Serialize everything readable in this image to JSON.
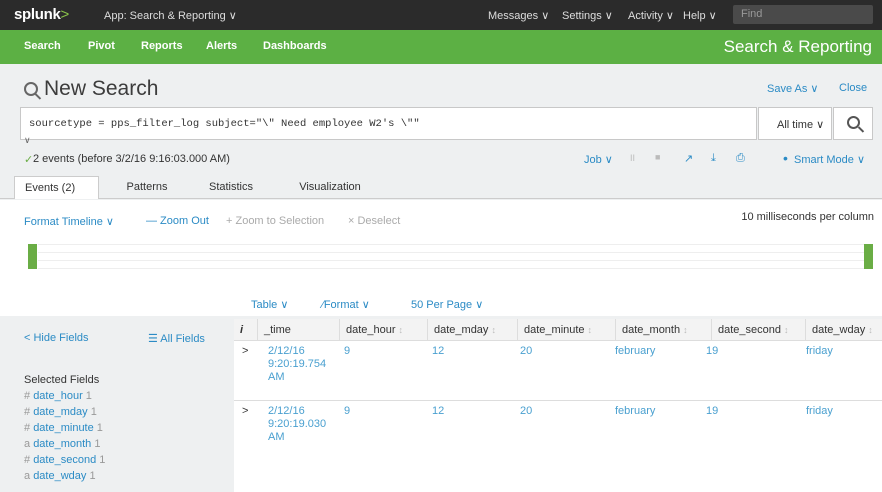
{
  "topbar": {
    "logo": "splunk",
    "logo_suffix": ">",
    "app": "App: Search & Reporting ∨",
    "messages": "Messages ∨",
    "settings": "Settings ∨",
    "activity": "Activity ∨",
    "help": "Help ∨",
    "find_placeholder": "Find"
  },
  "appnav": {
    "items": [
      "Search",
      "Pivot",
      "Reports",
      "Alerts",
      "Dashboards"
    ],
    "app_title": "Search & Reporting"
  },
  "page": {
    "title": "New Search",
    "save_as": "Save As ∨",
    "close": "Close"
  },
  "search": {
    "query": "sourcetype = pps_filter_log subject=\"\\\" Need employee W2's \\\"\"",
    "time_range": "All time ∨",
    "collapse": "∨"
  },
  "status": {
    "check": "✓",
    "events_text": "2 events (before 3/2/16 9:16:03.000 AM)",
    "job": "Job ∨",
    "pause": "II",
    "stop": "■",
    "share": "↗",
    "export": "⤓",
    "print": "⎙",
    "bulb": "•",
    "mode": "Smart Mode ∨"
  },
  "tabs": [
    "Events (2)",
    "Patterns",
    "Statistics",
    "Visualization"
  ],
  "timeline": {
    "format": "Format Timeline ∨",
    "zoom_out": "— Zoom Out",
    "zoom_selection": "+ Zoom to Selection",
    "deselect": "× Deselect",
    "scale": "10 milliseconds per column"
  },
  "toolbar": {
    "table": "Table ∨",
    "format": "∕Format ∨",
    "per_page": "50 Per Page ∨"
  },
  "fields": {
    "hide": "< Hide Fields",
    "all": "☰ All Fields",
    "selected_heading": "Selected Fields",
    "list": [
      {
        "type": "#",
        "name": "date_hour",
        "count": "1"
      },
      {
        "type": "#",
        "name": "date_mday",
        "count": "1"
      },
      {
        "type": "#",
        "name": "date_minute",
        "count": "1"
      },
      {
        "type": "a",
        "name": "date_month",
        "count": "1"
      },
      {
        "type": "#",
        "name": "date_second",
        "count": "1"
      },
      {
        "type": "a",
        "name": "date_wday",
        "count": "1"
      }
    ]
  },
  "table": {
    "info_col": "i",
    "headers": [
      "_time",
      "date_hour",
      "date_mday",
      "date_minute",
      "date_month",
      "date_second",
      "date_wday"
    ],
    "sort_glyph": "↕",
    "rows": [
      {
        "expand": ">",
        "time_line1": "2/12/16",
        "time_line2": "9:20:19.754",
        "time_line3": "AM",
        "date_hour": "9",
        "date_mday": "12",
        "date_minute": "20",
        "date_month": "february",
        "date_second": "19",
        "date_wday": "friday"
      },
      {
        "expand": ">",
        "time_line1": "2/12/16",
        "time_line2": "9:20:19.030",
        "time_line3": "AM",
        "date_hour": "9",
        "date_mday": "12",
        "date_minute": "20",
        "date_month": "february",
        "date_second": "19",
        "date_wday": "friday"
      }
    ]
  },
  "colors": {
    "topbar": "#2b2b2b",
    "appbar": "#5cb044",
    "link": "#2b8bc5",
    "timeline_bar": "#6aad45"
  }
}
